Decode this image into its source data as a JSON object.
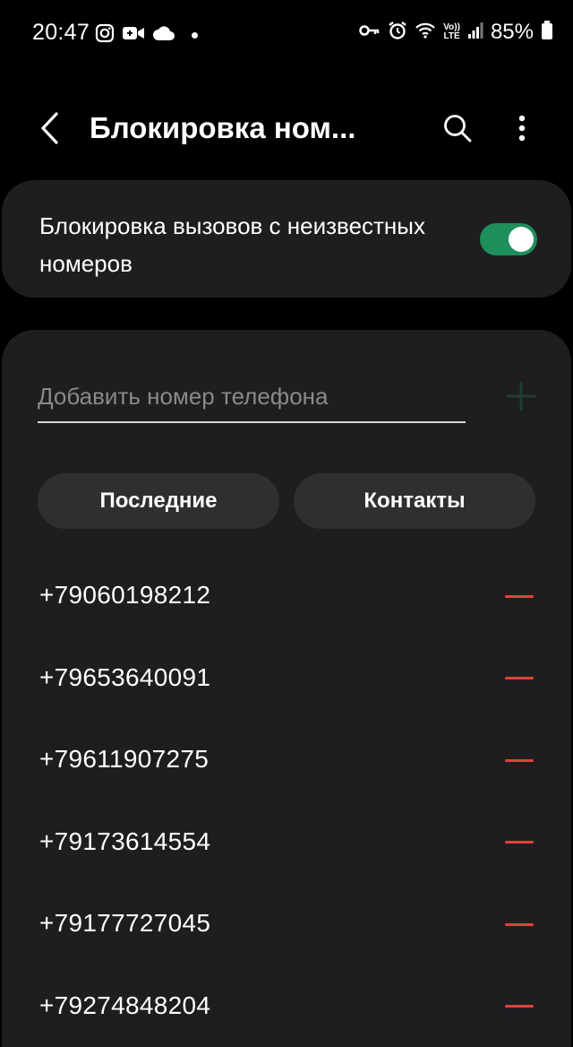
{
  "status_bar": {
    "time": "20:47",
    "battery": "85%",
    "left_icons": [
      "instagram-icon",
      "video-call-icon",
      "cloud-icon",
      "dot-icon"
    ],
    "right_icons": [
      "vpn-key-icon",
      "alarm-icon",
      "wifi-icon",
      "volte-lte-icon",
      "signal-icon",
      "battery-icon"
    ],
    "volte_top": "Vo))",
    "volte_bottom": "LTE"
  },
  "app_bar": {
    "title": "Блокировка ном...",
    "back_icon": "chevron-left-icon",
    "search_icon": "search-icon",
    "more_icon": "more-vertical-icon"
  },
  "unknown_block": {
    "label": "Блокировка вызовов с неизвестных номеров",
    "enabled": true,
    "toggle_color": "#1e8e5a"
  },
  "add_number": {
    "placeholder": "Добавить номер телефона",
    "value": "",
    "add_icon": "plus-icon"
  },
  "buttons": {
    "recent": "Последние",
    "contacts": "Контакты"
  },
  "blocked_numbers": [
    "+79060198212",
    "+79653640091",
    "+79611907275",
    "+79173614554",
    "+79177727045",
    "+79274848204"
  ],
  "colors": {
    "accent_green": "#1e8e5a",
    "remove_red": "#e0423a",
    "card_bg": "#1e1e20",
    "pill_bg": "#2f2f31"
  }
}
